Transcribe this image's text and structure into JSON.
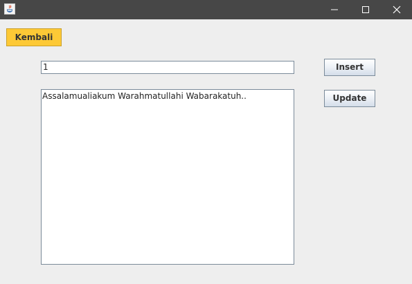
{
  "window": {
    "title_bar_color": "#474747",
    "icon": "java-app-icon",
    "controls": {
      "minimize_icon": "minimize-icon",
      "maximize_icon": "maximize-icon",
      "close_icon": "close-icon"
    }
  },
  "form": {
    "back_button_label": "Kembali",
    "back_button_color": "#fdc936",
    "id_field_value": "1",
    "message_area_value": "Assalamualiakum Warahmatullahi Wabarakatuh..",
    "insert_button_label": "Insert",
    "update_button_label": "Update"
  }
}
